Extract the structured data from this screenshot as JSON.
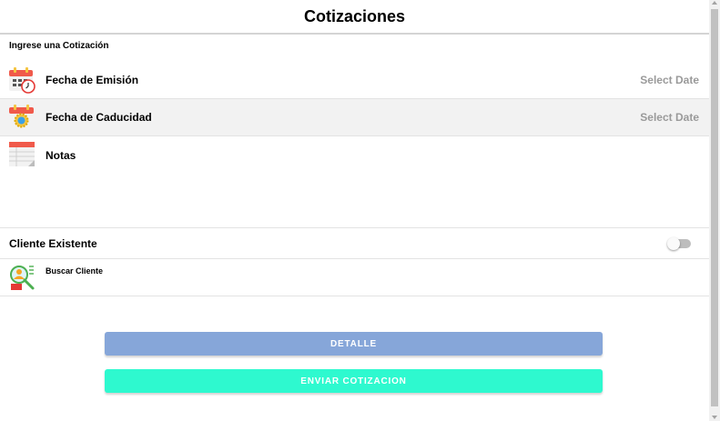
{
  "header": {
    "title": "Cotizaciones"
  },
  "form": {
    "section_label": "Ingrese una Cotización",
    "fecha_emision": {
      "label": "Fecha de Emisión",
      "value": "Select Date",
      "icon": "calendar-clock-icon"
    },
    "fecha_caducidad": {
      "label": "Fecha de Caducidad",
      "value": "Select Date",
      "icon": "calendar-gear-icon"
    },
    "notas": {
      "label": "Notas",
      "icon": "notes-icon"
    },
    "cliente_existente": {
      "label": "Cliente Existente",
      "toggle_on": false
    },
    "buscar_cliente": {
      "label": "Buscar Cliente",
      "icon": "search-user-icon"
    }
  },
  "buttons": {
    "detalle": "DETALLE",
    "enviar": "ENVIAR COTIZACION"
  },
  "colors": {
    "detalle_button": "#86a6d9",
    "enviar_button": "#2ef9cf",
    "placeholder_text": "#9a9a9a"
  }
}
